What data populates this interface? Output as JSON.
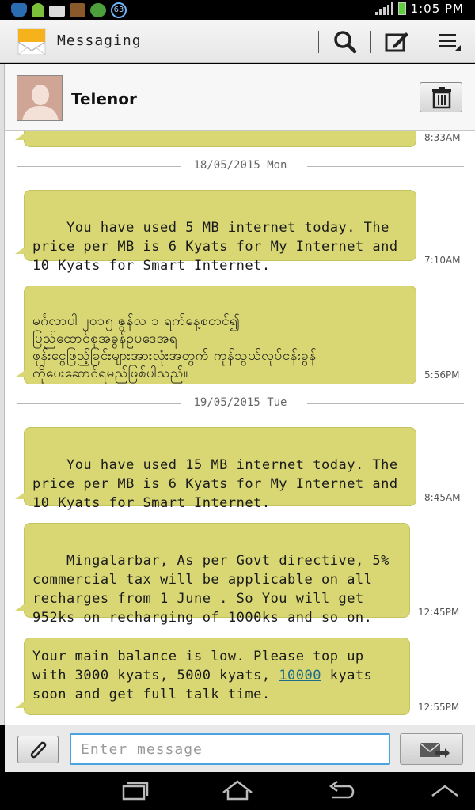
{
  "status_bar": {
    "time": "1:05 PM",
    "badge_count": "63",
    "icons": [
      "shield-icon",
      "android-icon",
      "mail-icon",
      "book-icon",
      "globe-icon"
    ],
    "battery_color": "#5fd23a"
  },
  "action_bar": {
    "title": "Messaging",
    "icons": [
      "messaging-app-icon",
      "search-icon",
      "compose-icon",
      "menu-icon"
    ]
  },
  "contact": {
    "name": "Telenor"
  },
  "conversation": {
    "partial_time": "8:33AM",
    "date_dividers": [
      "18/05/2015 Mon",
      "19/05/2015 Tue"
    ],
    "messages": [
      {
        "text": "You have used 5 MB internet today. The\nprice per MB is 6 Kyats for My Internet and\n10 Kyats for Smart Internet.",
        "time": "7:10AM"
      },
      {
        "text": "မင်္ဂလာပါ ၂၀၁၅ ဇွန်လ ၁ ရက်နေ့စတင်၍\nပြည်ထောင်စုအခွန်ဥပဒေအရ\nဖုန်းငွေဖြည့်ခြင်းများအားလုံးအတွက် ကုန်သွယ်လုပ်ငန်းခွန်\nကိုပေးဆောင်ရမည်ဖြစ်ပါသည်။",
        "time": "5:56PM"
      },
      {
        "text": "You have used 15 MB internet today. The\nprice per MB is 6 Kyats for My Internet and\n10 Kyats for Smart Internet.",
        "time": "8:45AM"
      },
      {
        "text": "Mingalarbar, As per Govt directive, 5%\ncommercial tax will be applicable on all\nrecharges from 1 June . So You will get\n952ks on recharging of 1000ks and so on.",
        "time": "12:45PM"
      },
      {
        "text_before": "Your main balance is low. Please top up\nwith 3000 kyats, 5000 kyats, ",
        "link": "10000",
        "text_after": " kyats\nsoon and get full talk time.",
        "time": "12:55PM"
      }
    ],
    "bubble_color": "#d8d774"
  },
  "compose": {
    "placeholder": "Enter message",
    "icons": [
      "paperclip-icon",
      "send-icon"
    ]
  },
  "nav_bar": {
    "icons": [
      "recent-apps-icon",
      "home-icon",
      "back-icon",
      "up-chevron-icon"
    ]
  }
}
